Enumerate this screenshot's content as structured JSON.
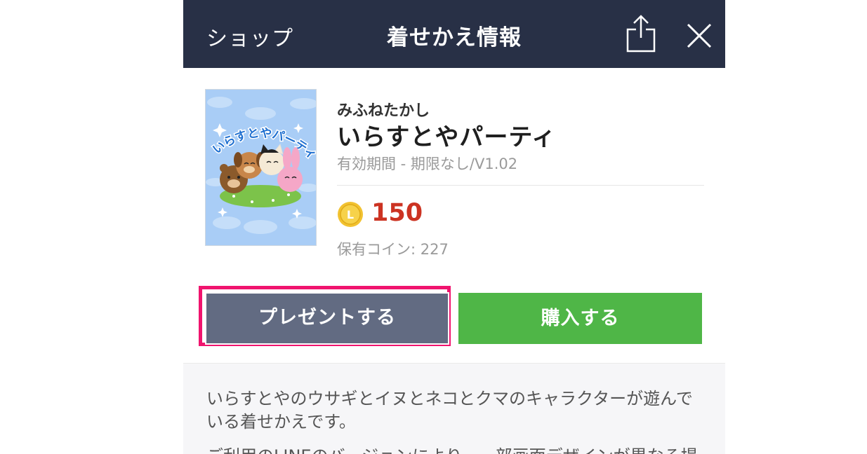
{
  "header": {
    "back_label": "ショップ",
    "title": "着せかえ情報",
    "share_icon": "share-icon",
    "close_icon": "close-icon"
  },
  "product": {
    "author": "みふねたかし",
    "title": "いらすとやパーティ",
    "validity": "有効期間 - 期限なし/V1.02",
    "price": "150",
    "coin_icon": "line-coin-icon",
    "coin_letter": "L",
    "owned_coins": "保有コイン: 227",
    "thumbnail_text": "いらすとやパーティ"
  },
  "actions": {
    "present_label": "プレゼントする",
    "buy_label": "購入する"
  },
  "description": {
    "text": "いらすとやのウサギとイヌとネコとクマのキャラクターが遊んでいる着せかえです。",
    "note": "ご利用のLINEのバージョンにより、一部画面デザインが異なる場"
  },
  "colors": {
    "header_bg": "#283046",
    "present_btn": "#626b82",
    "buy_btn": "#4fb647",
    "price": "#cc3322",
    "highlight": "#f0146e"
  }
}
